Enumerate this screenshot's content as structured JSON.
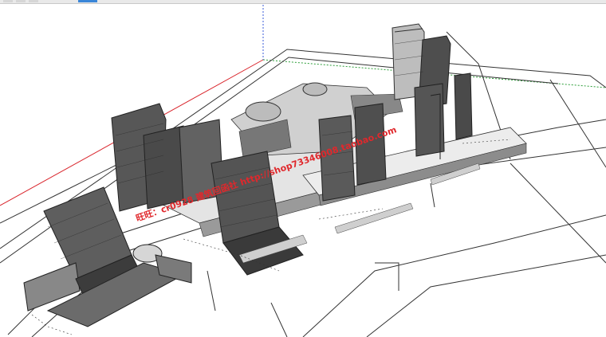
{
  "window": {
    "app": "SketchUp model viewport",
    "active_toolbar_button_color": "#3a86d8"
  },
  "viewport": {
    "background": "#ffffff",
    "axes": {
      "red_axis_color": "#d9232a",
      "green_axis_color": "#2e9e3a",
      "blue_axis_color": "#3a5bd9"
    },
    "model": {
      "building_color": "#5a5a5a",
      "building_dark": "#3c3c3c",
      "building_light": "#8a8a8a",
      "ground_line_color": "#333333"
    },
    "watermark": {
      "text": "旺旺：cr0928 建筑回函社 http://shop73346008.taobao.com",
      "color": "#e0282c"
    }
  }
}
